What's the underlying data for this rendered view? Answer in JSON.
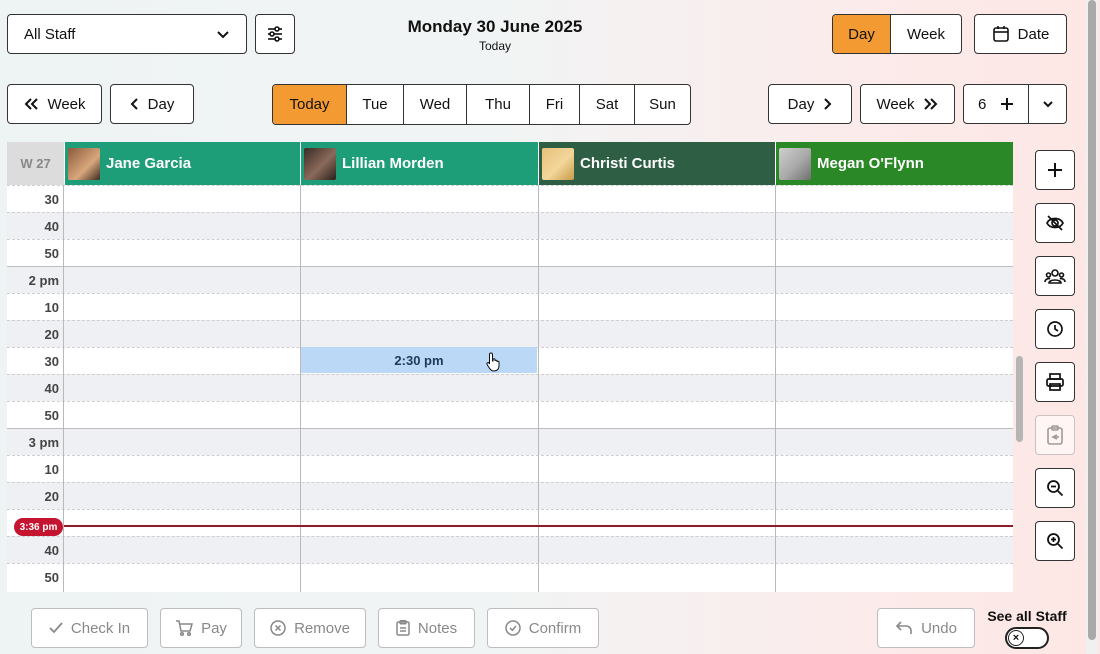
{
  "top": {
    "staff_select": "All Staff",
    "title": "Monday 30 June 2025",
    "subtitle": "Today",
    "view_options": [
      "Day",
      "Week"
    ],
    "active_view": "Day",
    "date_label": "Date"
  },
  "nav": {
    "prev_week": "Week",
    "prev_day": "Day",
    "days": [
      "Today",
      "Tue",
      "Wed",
      "Thu",
      "Fri",
      "Sat",
      "Sun"
    ],
    "active_day": "Today",
    "next_day": "Day",
    "next_week": "Week",
    "column_count": "6"
  },
  "schedule": {
    "week_label": "W 27",
    "staff": [
      {
        "name": "Jane Garcia",
        "color": "#1e9e78"
      },
      {
        "name": "Lillian Morden",
        "color": "#1e9e78"
      },
      {
        "name": "Christi Curtis",
        "color": "#2e5e44"
      },
      {
        "name": "Megan O'Flynn",
        "color": "#2a8826"
      }
    ],
    "time_labels": [
      "30",
      "40",
      "50",
      "2 pm",
      "10",
      "20",
      "30",
      "40",
      "50",
      "3 pm",
      "10",
      "20",
      "",
      "40",
      "50"
    ],
    "appointment": "2:30 pm",
    "current_time": "3:36 pm"
  },
  "tools": [
    "plus-icon",
    "eye-off-icon",
    "group-icon",
    "clock-icon",
    "printer-icon",
    "clipboard-icon",
    "zoom-out-icon",
    "zoom-in-icon"
  ],
  "bottom": {
    "check_in": "Check In",
    "pay": "Pay",
    "remove": "Remove",
    "notes": "Notes",
    "confirm": "Confirm",
    "undo": "Undo",
    "see_all_staff": "See all Staff"
  },
  "colors": {
    "accent": "#f39a33",
    "now": "#c4142f",
    "appointment": "#bcd8f7"
  }
}
